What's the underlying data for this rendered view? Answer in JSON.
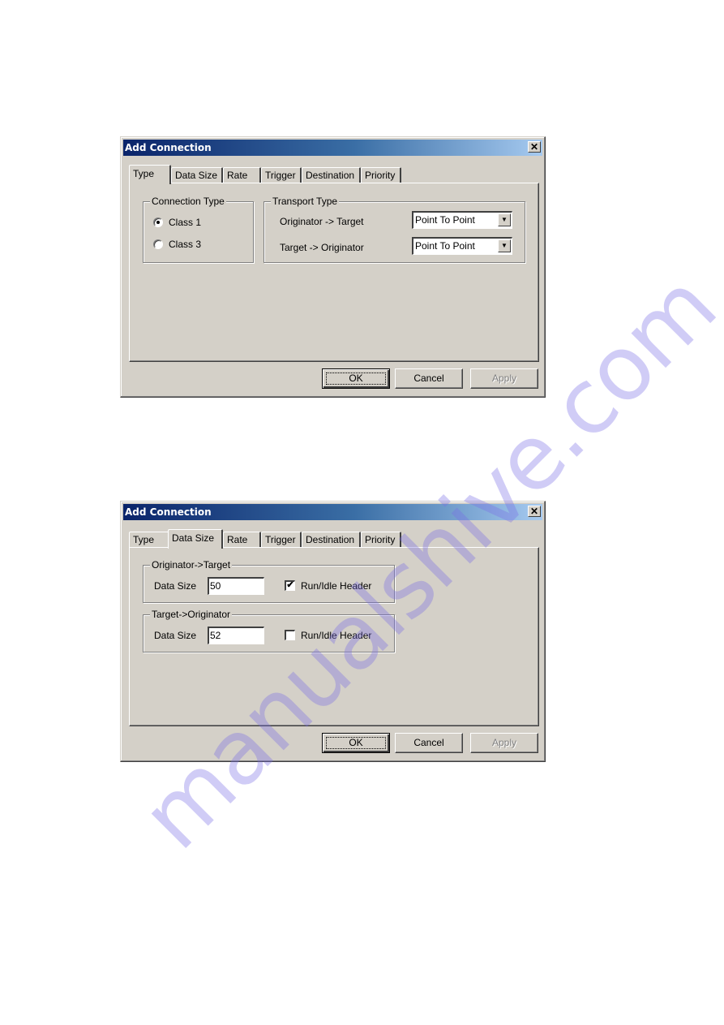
{
  "dialogs": [
    {
      "title": "Add Connection",
      "close_glyph": "✕",
      "tabs": [
        "Type",
        "Data Size",
        "Rate",
        "Trigger",
        "Destination",
        "Priority"
      ],
      "selected_tab": "Type",
      "connection_type": {
        "legend": "Connection Type",
        "options": [
          {
            "label": "Class 1",
            "selected": true
          },
          {
            "label": "Class 3",
            "selected": false
          }
        ]
      },
      "transport_type": {
        "legend": "Transport Type",
        "rows": [
          {
            "label": "Originator -> Target",
            "value": "Point To Point"
          },
          {
            "label": "Target -> Originator",
            "value": "Point To Point"
          }
        ]
      },
      "buttons": {
        "ok": "OK",
        "cancel": "Cancel",
        "apply": "Apply"
      }
    },
    {
      "title": "Add Connection",
      "close_glyph": "✕",
      "tabs": [
        "Type",
        "Data Size",
        "Rate",
        "Trigger",
        "Destination",
        "Priority"
      ],
      "selected_tab": "Data Size",
      "groups": [
        {
          "legend": "Originator->Target",
          "data_size_label": "Data Size",
          "data_size": "50",
          "run_idle_label": "Run/Idle Header",
          "run_idle_checked": true
        },
        {
          "legend": "Target->Originator",
          "data_size_label": "Data Size",
          "data_size": "52",
          "run_idle_label": "Run/Idle Header",
          "run_idle_checked": false
        }
      ],
      "buttons": {
        "ok": "OK",
        "cancel": "Cancel",
        "apply": "Apply"
      }
    }
  ],
  "icons": {
    "dropdown_arrow": "▼",
    "check": "✔"
  },
  "watermark": "manualshive.com"
}
